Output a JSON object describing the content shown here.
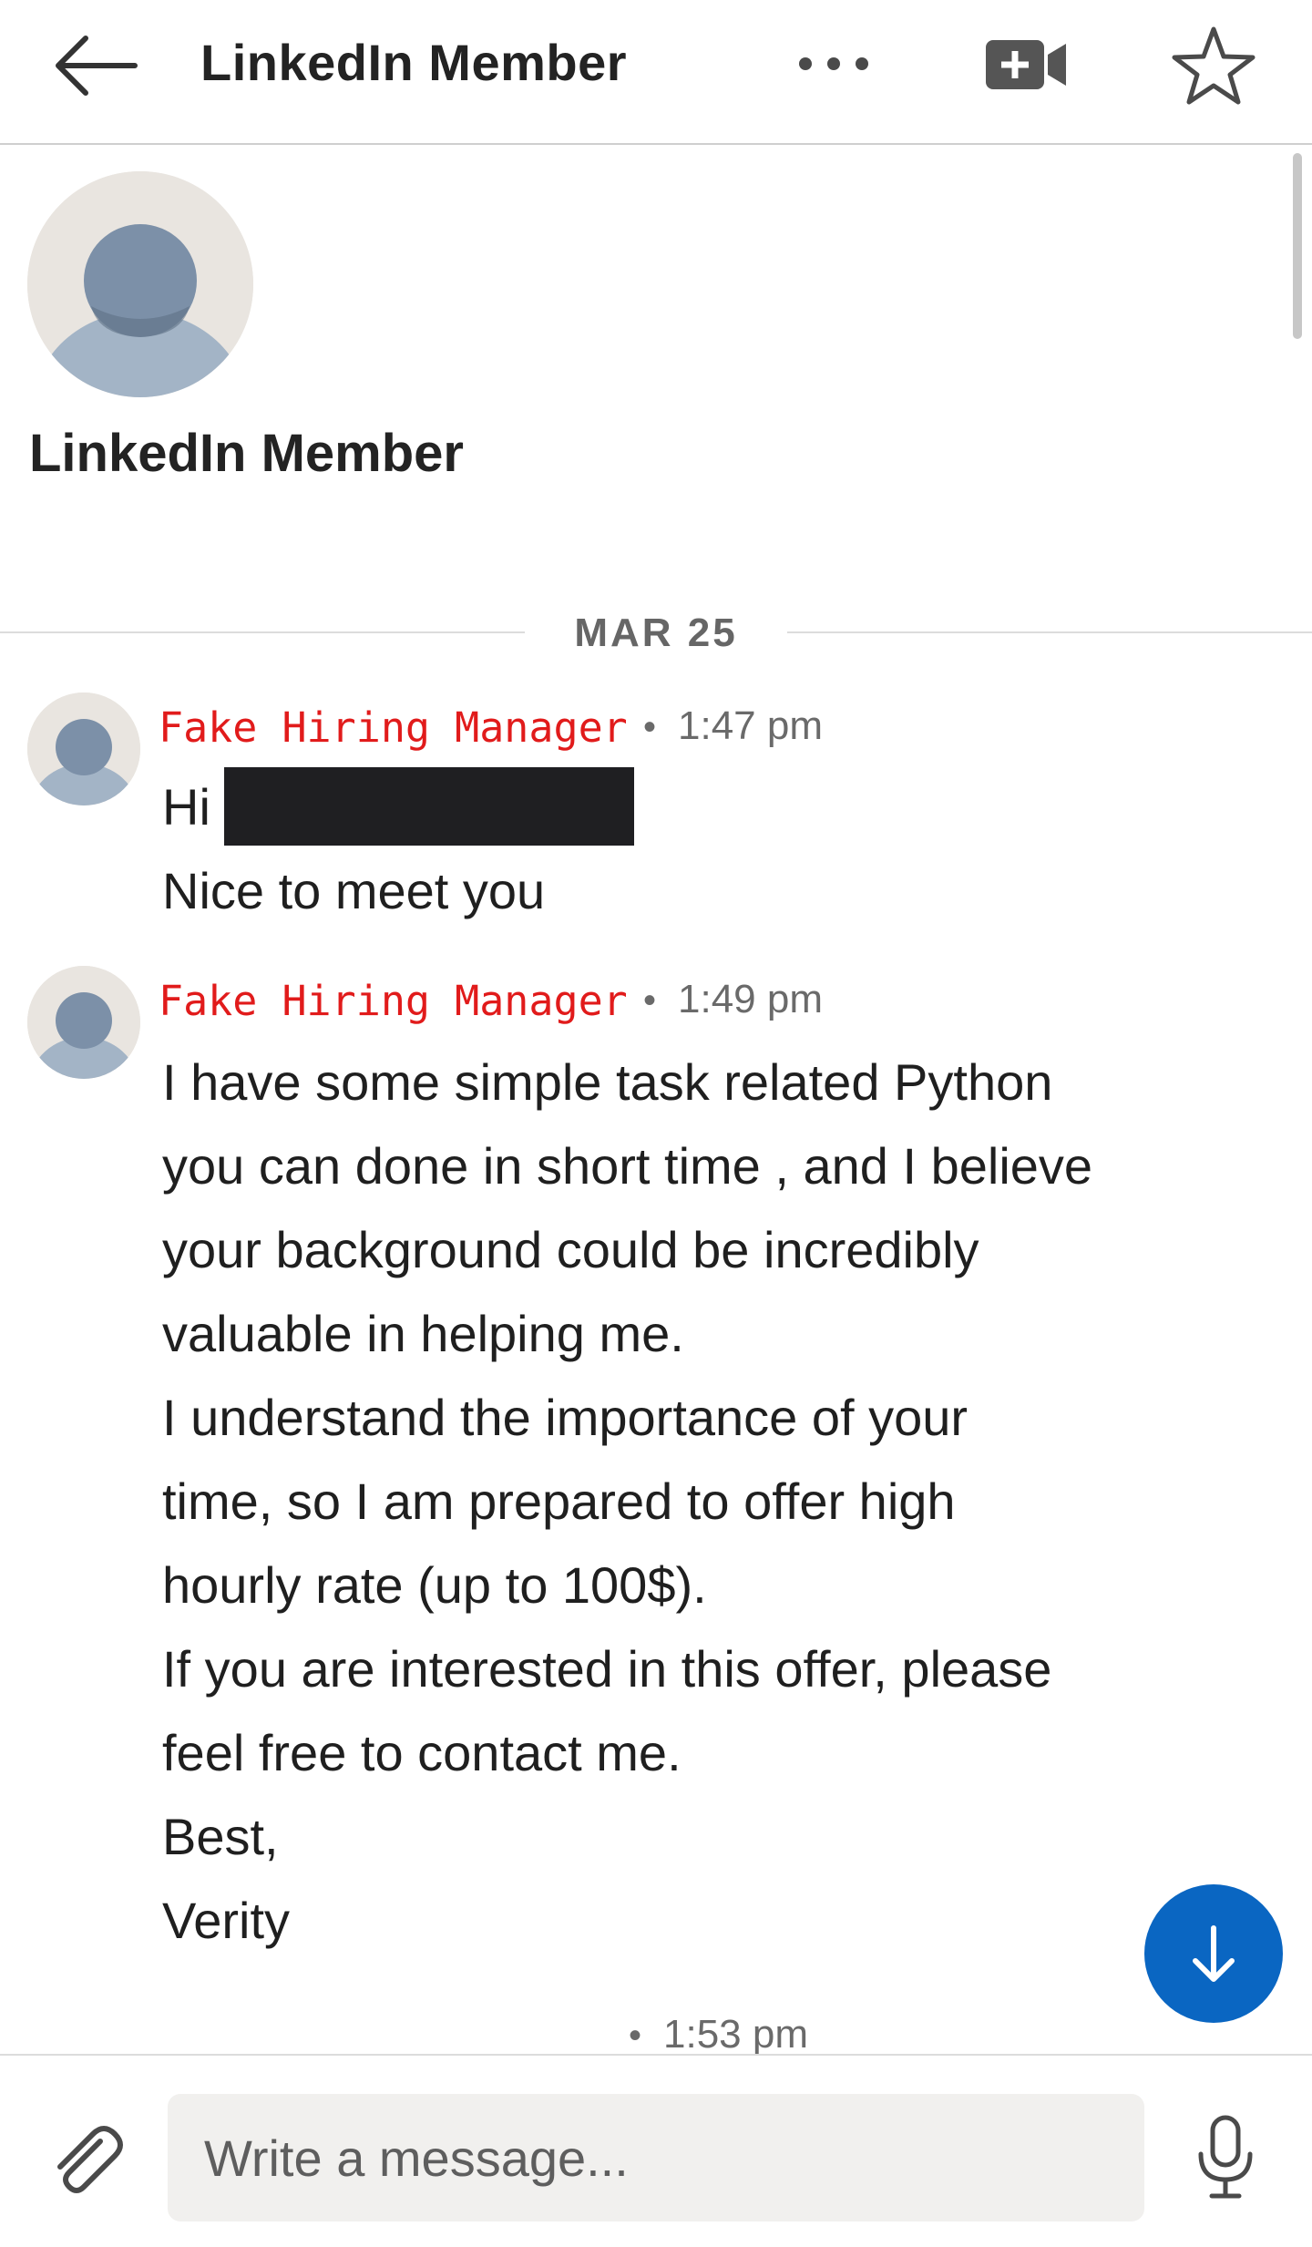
{
  "header": {
    "title": "LinkedIn Member"
  },
  "profile": {
    "name": "LinkedIn Member"
  },
  "divider": {
    "date": "MAR 25"
  },
  "messages": [
    {
      "sender": "Fake Hiring Manager",
      "time": "1:47 pm",
      "lines": [
        "Hi",
        "Nice to meet you"
      ]
    },
    {
      "sender": "Fake Hiring Manager",
      "time": "1:49 pm",
      "lines": [
        "I have some simple task related Python",
        "you can done in short time , and I believe",
        "your background could be incredibly",
        "valuable in helping me.",
        "I understand the importance of your",
        "time, so I am prepared to offer high",
        "hourly rate (up to 100$).",
        "If you are interested in this offer, please",
        "feel free to contact me.",
        "Best,",
        "Verity"
      ]
    },
    {
      "time": "1:53 pm"
    }
  ],
  "compose": {
    "placeholder": "Write a message..."
  },
  "icons": {
    "back": "arrow-left-icon",
    "more": "more-horizontal-icon",
    "video": "video-call-icon",
    "star": "star-icon",
    "jump": "arrow-down-icon",
    "attach": "paperclip-icon",
    "mic": "microphone-icon"
  },
  "colors": {
    "accent": "#0a66c2",
    "sender_highlight": "#e11b1b"
  }
}
